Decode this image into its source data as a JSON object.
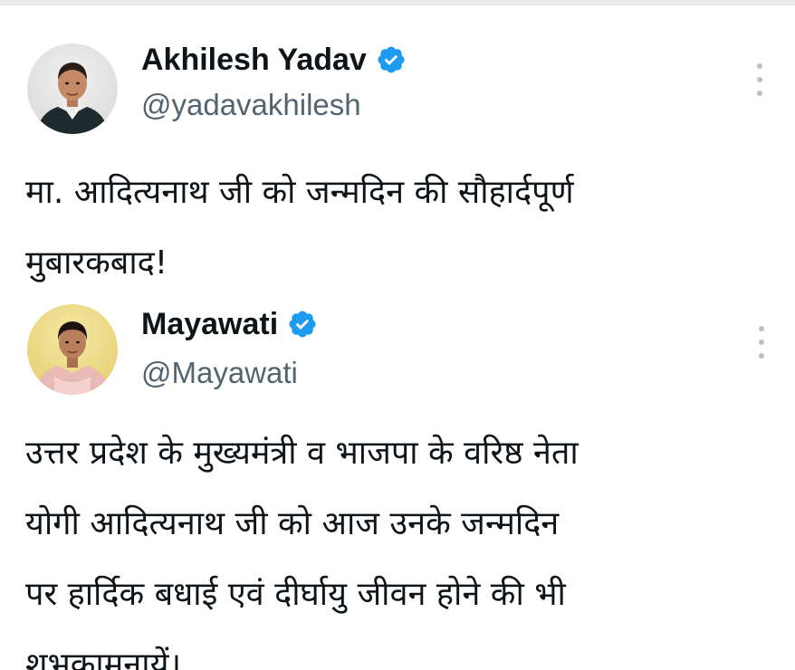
{
  "tweets": [
    {
      "display_name": "Akhilesh Yadav",
      "handle": "@yadavakhilesh",
      "verified": true,
      "avatar_icon": "avatar-photo-man-white-kurta",
      "text": "मा. आदित्यनाथ जी को जन्मदिन की सौहार्दपूर्ण\nमुबारकबाद!"
    },
    {
      "display_name": "Mayawati",
      "handle": "@Mayawati",
      "verified": true,
      "avatar_icon": "avatar-photo-woman-pink-attire",
      "text": "उत्तर प्रदेश के मुख्यमंत्री व भाजपा के वरिष्ठ नेता\nयोगी आदित्यनाथ जी को आज उनके जन्मदिन\nपर हार्दिक बधाई एवं दीर्घायु जीवन होने की भी\nशुभकामनायें।"
    }
  ],
  "colors": {
    "verified_blue": "#1d9bf0",
    "handle_gray": "#536471",
    "more_icon_gray": "#b9c1c8"
  }
}
